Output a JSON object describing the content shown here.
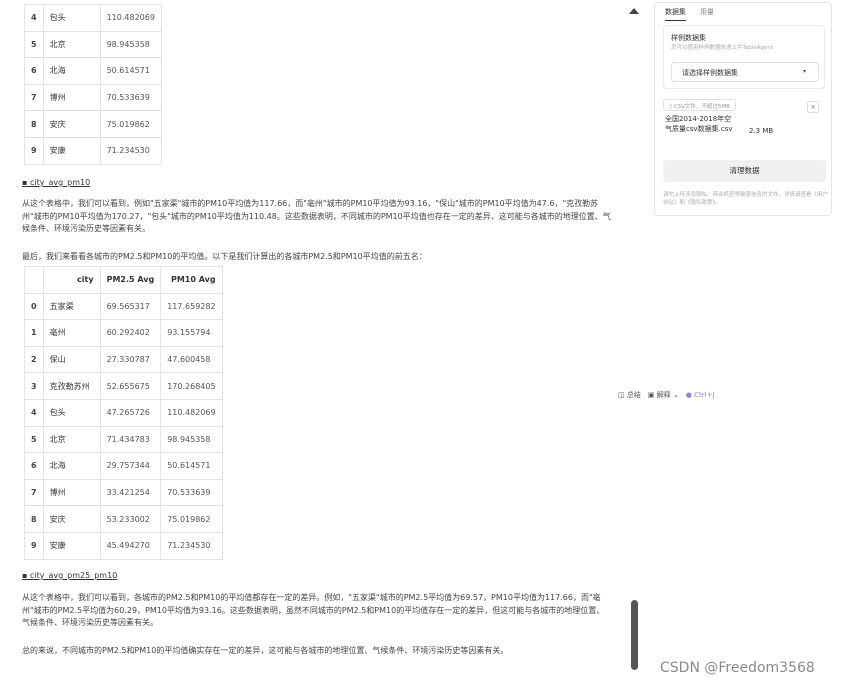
{
  "content": {
    "table1": {
      "rows": [
        {
          "idx": "4",
          "city": "包头",
          "pm10": "110.482069"
        },
        {
          "idx": "5",
          "city": "北京",
          "pm10": "98.945358"
        },
        {
          "idx": "6",
          "city": "北海",
          "pm10": "50.614571"
        },
        {
          "idx": "7",
          "city": "博州",
          "pm10": "70.533639"
        },
        {
          "idx": "8",
          "city": "安庆",
          "pm10": "75.019862"
        },
        {
          "idx": "9",
          "city": "安康",
          "pm10": "71.234530"
        }
      ]
    },
    "link1": "city_avg_pm10",
    "para1": "从这个表格中，我们可以看到，例如\"五家渠\"城市的PM10平均值为117.66，而\"亳州\"城市的PM10平均值为93.16，\"保山\"城市的PM10平均值为47.6，\"克孜勒苏州\"城市的PM10平均值为170.27，\"包头\"城市的PM10平均值为110.48。这些数据表明，不同城市的PM10平均值也存在一定的差异，这可能与各城市的地理位置、气候条件、环境污染历史等因素有关。",
    "para2": "最后，我们来看看各城市的PM2.5和PM10的平均值。以下是我们计算出的各城市PM2.5和PM10平均值的前五名：",
    "table2": {
      "headers": {
        "city": "city",
        "pm25": "PM2.5 Avg",
        "pm10": "PM10 Avg"
      },
      "rows": [
        {
          "idx": "0",
          "city": "五家渠",
          "pm25": "69.565317",
          "pm10": "117.659282"
        },
        {
          "idx": "1",
          "city": "亳州",
          "pm25": "60.292402",
          "pm10": "93.155794"
        },
        {
          "idx": "2",
          "city": "保山",
          "pm25": "27.330787",
          "pm10": "47.600458"
        },
        {
          "idx": "3",
          "city": "克孜勒苏州",
          "pm25": "52.655675",
          "pm10": "170.268405"
        },
        {
          "idx": "4",
          "city": "包头",
          "pm25": "47.265726",
          "pm10": "110.482069"
        },
        {
          "idx": "5",
          "city": "北京",
          "pm25": "71.434783",
          "pm10": "98.945358"
        },
        {
          "idx": "6",
          "city": "北海",
          "pm25": "29.757344",
          "pm10": "50.614571"
        },
        {
          "idx": "7",
          "city": "博州",
          "pm25": "33.421254",
          "pm10": "70.533639"
        },
        {
          "idx": "8",
          "city": "安庆",
          "pm25": "53.233002",
          "pm10": "75.019862"
        },
        {
          "idx": "9",
          "city": "安康",
          "pm25": "45.494270",
          "pm10": "71.234530"
        }
      ]
    },
    "link2": "city_avg_pm25_pm10",
    "para3": "从这个表格中，我们可以看到，各城市的PM2.5和PM10的平均值都存在一定的差异。例如，\"五家渠\"城市的PM2.5平均值为69.57，PM10平均值为117.66，而\"亳州\"城市的PM2.5平均值为60.29，PM10平均值为93.16。这些数据表明，虽然不同城市的PM2.5和PM10的平均值存在一定的差异，但这可能与各城市的地理位置、气候条件、环境污染历史等因素有关。",
    "para4": "总的来说，不同城市的PM2.5和PM10的平均值确实存在一定的差异，这可能与各城市的地理位置、气候条件、环境污染历史等因素有关。"
  },
  "panel": {
    "tabs": [
      "数据集",
      "用量"
    ],
    "sample": {
      "title": "样例数据集",
      "desc": "您可以使用样例数据快速上手TableAgent",
      "select_placeholder": "请选择样例数据集"
    },
    "upload_hint": "CSV文件，不超过5MB",
    "file_name": "全国2014-2018年空气质量csv数据集.csv",
    "file_size": "2.3 MB",
    "clean_button": "清理数据",
    "disclaimer": "请勿上传涉及隐私、商业机密等敏感信息的文件。详情请查看《用户协议》和《隐私政策》。"
  },
  "toolbar": {
    "summary": "总结",
    "explain": "解释",
    "shortcut": "Ctrl+J"
  },
  "watermark": "CSDN @Freedom3568"
}
